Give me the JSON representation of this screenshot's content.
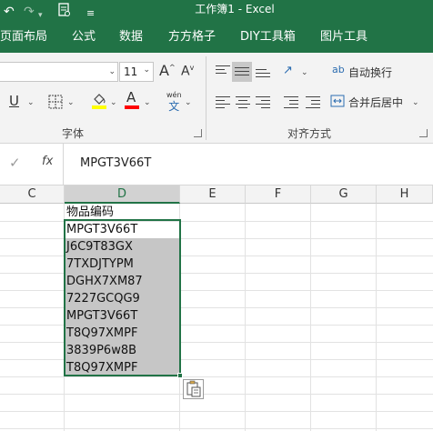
{
  "titlebar": {
    "title": "工作簿1  -  Excel",
    "qa_icons": [
      "redo-icon",
      "print-preview-icon",
      "customize-toolbar-icon"
    ],
    "bg_color": "#217346"
  },
  "menu": {
    "tabs": [
      "页面布局",
      "公式",
      "数据",
      "方方格子",
      "DIY工具箱",
      "图片工具"
    ]
  },
  "ribbon": {
    "font_name_value": "",
    "font_size_value": "11",
    "grow_font_label": "A",
    "shrink_font_label": "A",
    "underline_label": "U",
    "font_color_label": "A",
    "phonetic_top": "wén",
    "phonetic_bottom": "文",
    "wrap_text_label": "自动换行",
    "merge_center_label": "合并后居中",
    "font_group_label": "字体",
    "alignment_group_label": "对齐方式",
    "highlight_color": "#ffff00",
    "font_color": "#ff0000"
  },
  "formula_bar": {
    "fx_label": "fx",
    "value": "MPGT3V66T"
  },
  "grid": {
    "columns": [
      "C",
      "D",
      "E",
      "F",
      "G",
      "H"
    ],
    "selected_column": "D",
    "header_cell": "物品编码",
    "cells": [
      "MPGT3V66T",
      "J6C9T83GX",
      "7TXDJTYPM",
      "DGHX7XM87",
      "7227GCQG9",
      "MPGT3V66T",
      "T8Q97XMPF",
      "3839P6w8B",
      "T8Q97XMPF"
    ],
    "accent_color": "#217346"
  }
}
